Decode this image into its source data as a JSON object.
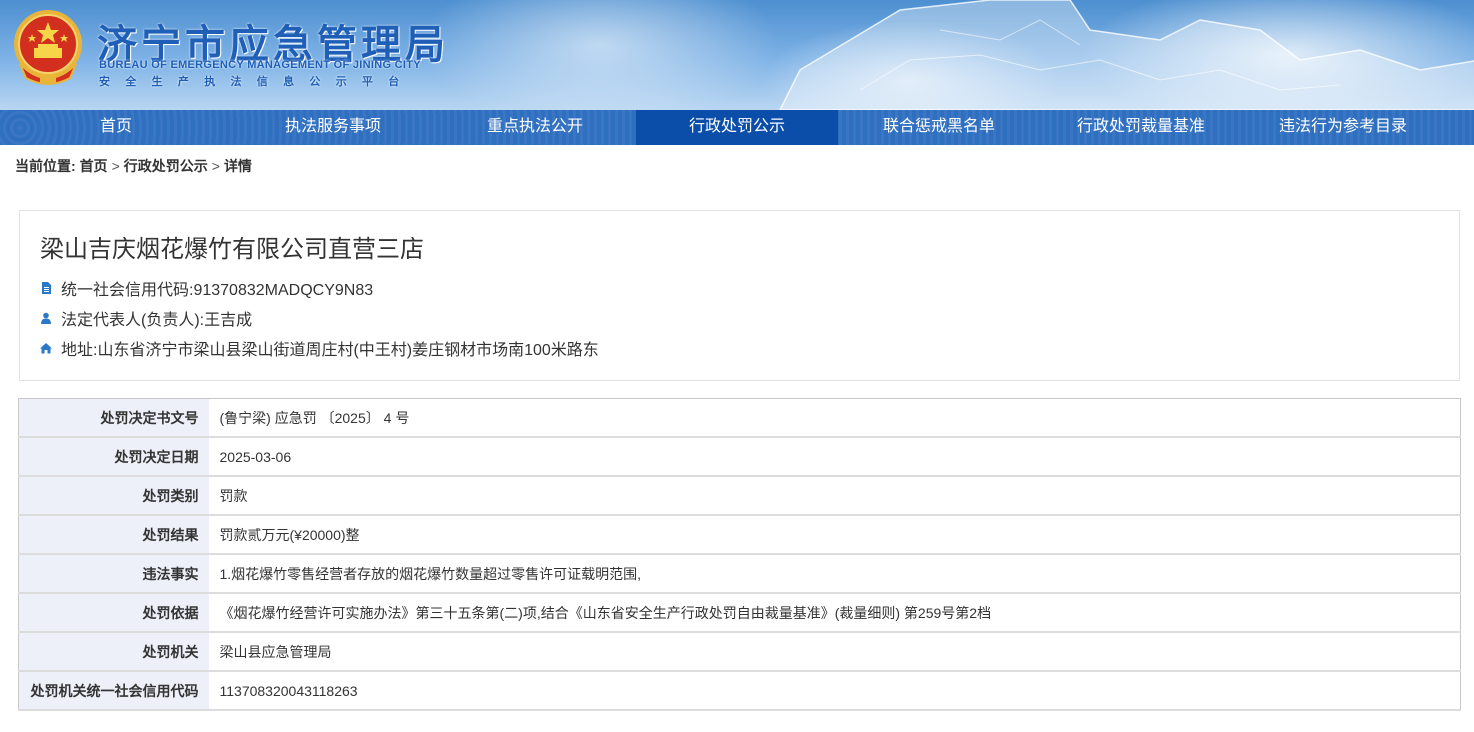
{
  "header": {
    "title": "济宁市应急管理局",
    "title_en": "BUREAU OF EMERGENCY MANAGEMENT OF JINING CITY",
    "subtitle": "安全生产执法信息公示平台"
  },
  "nav": {
    "items": [
      {
        "label": "首页"
      },
      {
        "label": "执法服务事项"
      },
      {
        "label": "重点执法公开"
      },
      {
        "label": "行政处罚公示",
        "active": true
      },
      {
        "label": "联合惩戒黑名单"
      },
      {
        "label": "行政处罚裁量基准"
      },
      {
        "label": "违法行为参考目录"
      }
    ]
  },
  "breadcrumb": {
    "prefix": "当前位置:",
    "items": [
      "首页",
      "行政处罚公示",
      "详情"
    ],
    "separator": ">"
  },
  "company": {
    "name": "梁山吉庆烟花爆竹有限公司直营三店",
    "credit_code": "统一社会信用代码:91370832MADQCY9N83",
    "legal_rep": "法定代表人(负责人):王吉成",
    "address": "地址:山东省济宁市梁山县梁山街道周庄村(中王村)姜庄钢材市场南100米路东",
    "icons": [
      "document-icon",
      "person-icon",
      "home-icon"
    ]
  },
  "details": {
    "rows": [
      {
        "label": "处罚决定书文号",
        "value": "(鲁宁梁) 应急罚 〔2025〕 4 号"
      },
      {
        "label": "处罚决定日期",
        "value": "2025-03-06"
      },
      {
        "label": "处罚类别",
        "value": "罚款"
      },
      {
        "label": "处罚结果",
        "value": "罚款贰万元(¥20000)整"
      },
      {
        "label": "违法事实",
        "value": "1.烟花爆竹零售经营者存放的烟花爆竹数量超过零售许可证载明范围,"
      },
      {
        "label": "处罚依据",
        "value": "《烟花爆竹经营许可实施办法》第三十五条第(二)项,结合《山东省安全生产行政处罚自由裁量基准》(裁量细则) 第259号第2档"
      },
      {
        "label": "处罚机关",
        "value": "梁山县应急管理局"
      },
      {
        "label": "处罚机关统一社会信用代码",
        "value": "113708320043118263"
      }
    ]
  },
  "colors": {
    "nav_bg": "#2f6fc0",
    "nav_active": "#0b4ea9",
    "title_blue": "#1f5fb8",
    "icon_blue": "#2a78c8",
    "label_bg": "#eef0f9"
  }
}
